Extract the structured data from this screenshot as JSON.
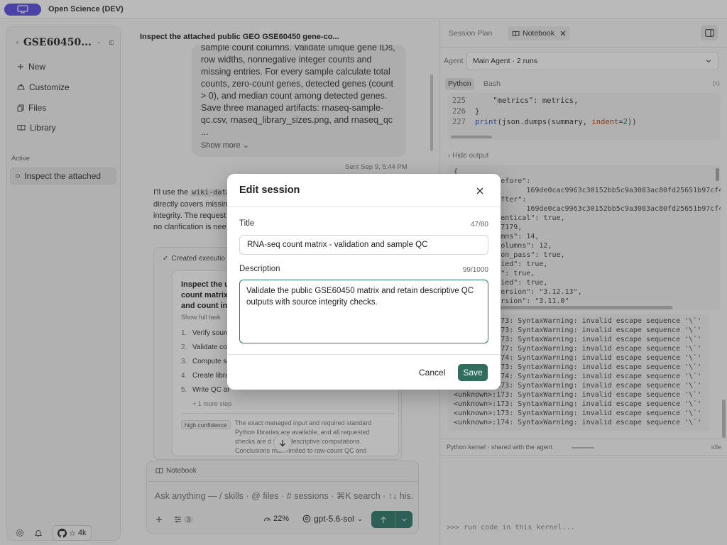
{
  "app": {
    "title": "Open Science (DEV)"
  },
  "colors": {
    "accent": "#2f7a6a",
    "brand": "#5b4fe6"
  },
  "sidebar": {
    "session_title": "GSE60450...",
    "items": [
      {
        "label": "New",
        "icon": "plus-icon"
      },
      {
        "label": "Customize",
        "icon": "palette-icon"
      },
      {
        "label": "Files",
        "icon": "files-icon"
      },
      {
        "label": "Library",
        "icon": "book-icon"
      }
    ],
    "section_label": "Active",
    "active_session": "Inspect the attached",
    "github_stars": "4k"
  },
  "chat": {
    "title": "Inspect the attached public GEO GSE60450 gene-co...",
    "user_message_lines": [
      "sample count columns. Validate unique gene IDs,",
      "row widths, nonnegative integer counts and",
      "missing entries. For every sample calculate total",
      "counts, zero-count genes, detected genes (count",
      "> 0), and median count among detected genes.",
      "Save three managed artifacts: rnaseq-sample-",
      "qc.csv, rnaseq_library_sizes.png, and rnaseq_qc",
      "..."
    ],
    "show_more": "Show more",
    "sent_time": "Sent Sep 9, 5:44 PM",
    "assistant": {
      "line1_pre": "I'll use the ",
      "line1_code": "wiki-data",
      "line2": "directly covers missin",
      "line3": "integrity. The request",
      "line4": "no clarification is nee"
    },
    "exec_header": "Created executio",
    "task_title_lines": [
      "Inspect the u",
      "count matrix",
      "and count int"
    ],
    "show_full_task": "Show full task",
    "steps": [
      {
        "n": "1.",
        "text": "Verify sourc"
      },
      {
        "n": "2.",
        "text": "Validate co"
      },
      {
        "n": "3.",
        "text": "Compute sa"
      },
      {
        "n": "4.",
        "text": "Create libra"
      },
      {
        "n": "5.",
        "text": "Write QC ar"
      }
    ],
    "more_steps": "+ 1 more step",
    "confidence": "high confidence",
    "confidence_lines": [
      "The exact managed input and required standard",
      "Python libraries are available, and all requested",
      "checks are d     nistic descriptive computations.",
      "Conclusions       main limited to raw-count QC and"
    ],
    "composer": {
      "notebook_label": "Notebook",
      "placeholder": "Ask anything — / skills · @ files · # sessions · ⌘K search · ↑↓ his...",
      "tools_count": "3",
      "context_pct": "22%",
      "model": "gpt-5.6-sol"
    }
  },
  "right_panel": {
    "tabs": {
      "session_plan": "Session Plan",
      "notebook": "Notebook"
    },
    "agent_label": "Agent",
    "agent_value": "Main Agent · 2 runs",
    "subtabs": {
      "python": "Python",
      "bash": "Bash"
    },
    "code_lines": [
      {
        "ln": "225",
        "text": "    \"metrics\": metrics,"
      },
      {
        "ln": "226",
        "text": "}"
      },
      {
        "ln": "227",
        "pre": "",
        "fn": "print",
        "mid": "(json.dumps(summary, ",
        "kw": "indent",
        "eq": "=",
        "num": "2",
        "post": "))"
      }
    ],
    "hide_output": "Hide output",
    "output_lines": [
      "{",
      "  \"sha256_before\":",
      "\"                169de0cac9963c30152bb5c9a3083ac80fd25651b97cf4b73",
      "  \"sha256_after\":",
      "\"                169de0cac9963c30152bb5c9a3083ac80fd25651b97cf4b73",
      "  \"input_identical\": true,",
      "  \"rows\": 27179,",
      "  \"raw_columns\": 14,",
      "  \"sample_columns\": 12,",
      "  \"validation_pass\": true,",
      "  \"...verified\": true,",
      "  \"...ified\": true,",
      "  \"...verified\": true,",
      "  \"python_version\": \"3.12.13\",",
      "  \"numpy_version\": \"3.11.0\""
    ],
    "warning_lines": [
      "<unknown>:173: SyntaxWarning: invalid escape sequence '\\`'",
      "<unknown>:173: SyntaxWarning: invalid escape sequence '\\`'",
      "<unknown>:173: SyntaxWarning: invalid escape sequence '\\`'",
      "<unknown>:177: SyntaxWarning: invalid escape sequence '\\`'",
      "<unknown>:174: SyntaxWarning: invalid escape sequence '\\`'",
      "<unknown>:173: SyntaxWarning: invalid escape sequence '\\`'",
      "<unknown>:174: SyntaxWarning: invalid escape sequence '\\`'",
      "<unknown>:173: SyntaxWarning: invalid escape sequence '\\`'",
      "<unknown>:173: SyntaxWarning: invalid escape sequence '\\`'",
      "<unknown>:173: SyntaxWarning: invalid escape sequence '\\`'",
      "<unknown>:173: SyntaxWarning: invalid escape sequence '\\`'",
      "<unknown>:174: SyntaxWarning: invalid escape sequence '\\`'"
    ],
    "kernel_status_text": "Python kernel · shared with the agent",
    "kernel_state": "idle",
    "kernel_prompt": ">>>",
    "kernel_placeholder": "run code in this kernel..."
  },
  "modal": {
    "title": "Edit session",
    "title_label": "Title",
    "title_count": "47/80",
    "title_value": "RNA-seq count matrix - validation and sample QC",
    "desc_label": "Description",
    "desc_count": "99/1000",
    "desc_value": "Validate the public GSE60450 matrix and retain descriptive QC outputs with source integrity checks.",
    "cancel": "Cancel",
    "save": "Save"
  }
}
